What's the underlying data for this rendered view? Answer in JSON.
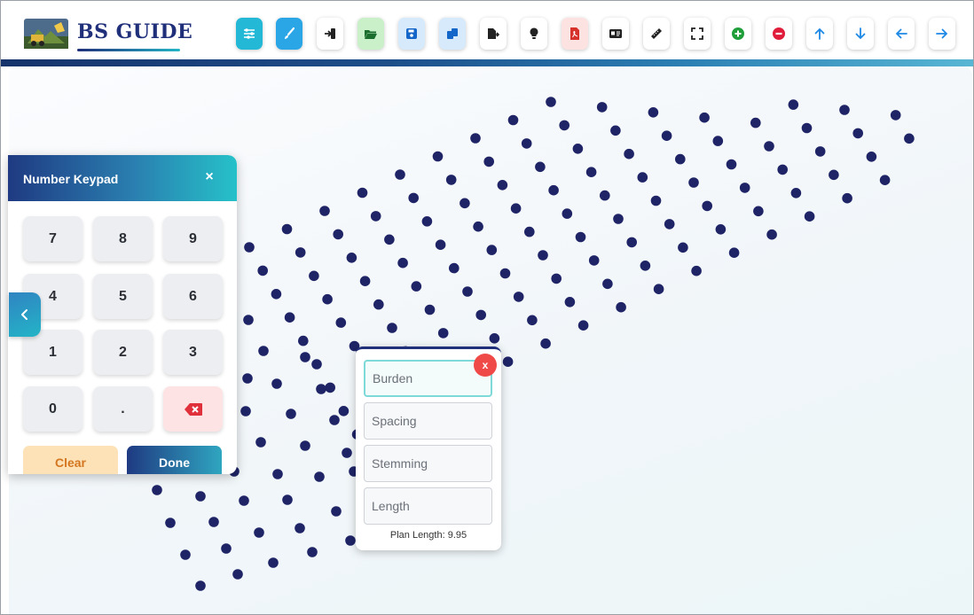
{
  "app": {
    "brand": "BS GUIDE"
  },
  "toolbar": {
    "buttons": [
      {
        "name": "settings-button",
        "icon": "sliders-icon",
        "bg": "#22b8d6",
        "fg": "#ffffff"
      },
      {
        "name": "draw-button",
        "icon": "brush-icon",
        "bg": "#2aa6e6",
        "fg": "#ffffff"
      },
      {
        "name": "import-button",
        "icon": "import-icon",
        "bg": "#ffffff",
        "fg": "#222222"
      },
      {
        "name": "open-button",
        "icon": "folder-open-icon",
        "bg": "#c9f0c9",
        "fg": "#1b6e2e"
      },
      {
        "name": "save-button",
        "icon": "save-icon",
        "bg": "#d6eafc",
        "fg": "#1466c8"
      },
      {
        "name": "copy-button",
        "icon": "copy-icon",
        "bg": "#d6eafc",
        "fg": "#1466c8"
      },
      {
        "name": "export-button",
        "icon": "export-icon",
        "bg": "#ffffff",
        "fg": "#222222"
      },
      {
        "name": "hint-button",
        "icon": "lightbulb-icon",
        "bg": "#ffffff",
        "fg": "#222222"
      },
      {
        "name": "pdf-button",
        "icon": "pdf-icon",
        "bg": "#fde2e2",
        "fg": "#d6322b"
      },
      {
        "name": "id-card-button",
        "icon": "id-card-icon",
        "bg": "#ffffff",
        "fg": "#222222"
      },
      {
        "name": "measure-button",
        "icon": "ruler-icon",
        "bg": "#ffffff",
        "fg": "#222222"
      },
      {
        "name": "fullscreen-button",
        "icon": "expand-icon",
        "bg": "#ffffff",
        "fg": "#222222"
      },
      {
        "name": "zoom-in-button",
        "icon": "plus-circle-icon",
        "bg": "#ffffff",
        "fg": "#1f9e3a"
      },
      {
        "name": "zoom-out-button",
        "icon": "minus-circle-icon",
        "bg": "#ffffff",
        "fg": "#e01e3c"
      },
      {
        "name": "move-up-button",
        "icon": "arrow-up-icon",
        "bg": "#ffffff",
        "fg": "#1e88e5"
      },
      {
        "name": "move-down-button",
        "icon": "arrow-down-icon",
        "bg": "#ffffff",
        "fg": "#1e88e5"
      },
      {
        "name": "move-left-button",
        "icon": "arrow-left-icon",
        "bg": "#ffffff",
        "fg": "#1e88e5"
      },
      {
        "name": "move-right-button",
        "icon": "arrow-right-icon",
        "bg": "#ffffff",
        "fg": "#1e88e5"
      }
    ]
  },
  "keypad": {
    "title": "Number Keypad",
    "close_label": "×",
    "keys": [
      "7",
      "8",
      "9",
      "4",
      "5",
      "6",
      "1",
      "2",
      "3",
      "0",
      "."
    ],
    "backspace_icon": "backspace-icon",
    "clear_label": "Clear",
    "done_label": "Done"
  },
  "form": {
    "close_label": "x",
    "fields": [
      {
        "name": "burden-field",
        "placeholder": "Burden",
        "value": ""
      },
      {
        "name": "spacing-field",
        "placeholder": "Spacing",
        "value": ""
      },
      {
        "name": "stemming-field",
        "placeholder": "Stemming",
        "value": ""
      },
      {
        "name": "length-field",
        "placeholder": "Length",
        "value": ""
      }
    ],
    "plan_length": "Plan Length: 9.95"
  },
  "colors": {
    "hole": "#1e2466",
    "brand": "#1f2f7a",
    "accent": "#26c1c9"
  }
}
